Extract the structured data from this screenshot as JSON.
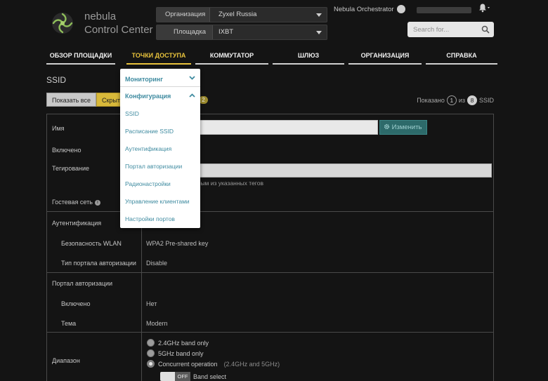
{
  "brand": {
    "line1": "nebula",
    "line2": "Control Center"
  },
  "selectors": {
    "org": {
      "label": "Организация",
      "value": "Zyxel Russia"
    },
    "site": {
      "label": "Площадка",
      "value": "IXBT"
    }
  },
  "orchestrator": {
    "label": "Nebula Orchestrator"
  },
  "search": {
    "placeholder": "Search for..."
  },
  "nav": {
    "site_overview": "ОБЗОР ПЛОЩАДКИ",
    "access_points": "ТОЧКИ ДОСТУПА",
    "switch": "КОММУТАТОР",
    "gateway": "ШЛЮЗ",
    "organization": "ОРГАНИЗАЦИЯ",
    "help": "СПРАВКА"
  },
  "page": {
    "title": "SSID"
  },
  "filter": {
    "show_all": "Показать все",
    "hide": "Скрыть",
    "count": "2"
  },
  "shown": {
    "prefix": "Показано",
    "current": "1",
    "of": "из",
    "total": "8",
    "suffix": "SSID"
  },
  "table": {
    "name_label": "Имя",
    "rename_button": "Изменить",
    "enabled_label": "Включено",
    "tagging_label": "Тегирование",
    "tagging_note": "...чках доступа с любым из указанных тегов",
    "guest_label": "Гостевая сеть",
    "auth_label": "Аутентификация",
    "wlan_security_label": "Безопасность WLAN",
    "wlan_security_value": "WPA2 Pre-shared key",
    "portal_type_label": "Тип портала авторизации",
    "portal_type_value": "Disable",
    "portal_label": "Портал авторизации",
    "portal_enabled_label": "Включено",
    "portal_enabled_value": "Нет",
    "theme_label": "Тема",
    "theme_value": "Modern",
    "band_label": "Диапазон",
    "band_opt1": "2.4GHz band only",
    "band_opt2": "5GHz band only",
    "band_opt3": "Concurrent operation",
    "band_opt3_note": "(2.4GHz and 5GHz)",
    "band_select_toggle": "OFF",
    "band_select_label": "Band select"
  },
  "menu": {
    "monitoring": "Мониторинг",
    "configuration": "Конфигурация",
    "items": [
      "SSID",
      "Расписание SSID",
      "Аутентификация",
      "Портал авторизации",
      "Радионастройки",
      "Управление клиентами",
      "Настройки портов"
    ]
  },
  "colors": {
    "accent": "#e9c33c",
    "menu_link": "#3f8ba0",
    "button_teal": "#2d6a6a",
    "background": "#141414"
  }
}
